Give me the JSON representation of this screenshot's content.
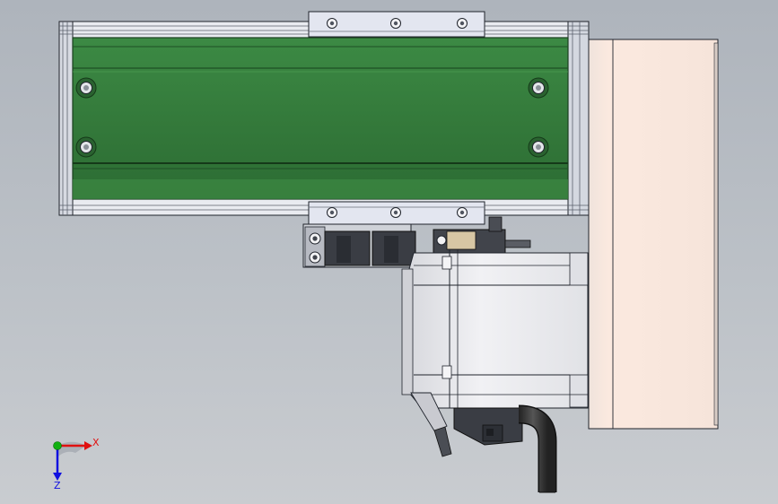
{
  "view": {
    "colors": {
      "background_top": "#aeb4bc",
      "background_bottom": "#c9ccd0",
      "carriage_plate": "#357a3c",
      "carriage_plate_dark": "#1f4f25",
      "rail_aluminum": "#e7e9ef",
      "end_block": "#f7e6dc",
      "motor_body": "#e9e9ed",
      "cable": "#3a3a3a",
      "edge_lines": "#20242c",
      "triad_x": "#e01010",
      "triad_y": "#10b010",
      "triad_z": "#1010e0"
    },
    "mounting_hole_count": 4,
    "slider_screw_count": 6
  },
  "triad": {
    "x_label": "X",
    "z_label": "Z"
  }
}
